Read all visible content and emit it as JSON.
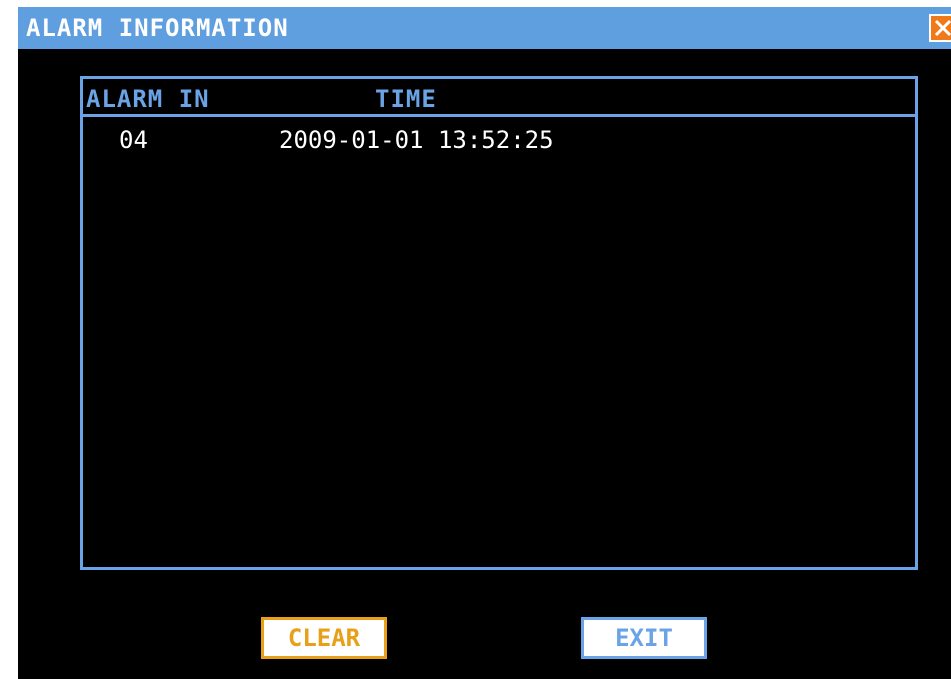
{
  "window": {
    "title": "ALARM INFORMATION"
  },
  "list": {
    "columns": {
      "alarm_in": "ALARM IN",
      "time": "TIME"
    },
    "rows": [
      {
        "alarm_in": "04",
        "time": "2009-01-01 13:52:25"
      }
    ]
  },
  "buttons": {
    "clear_label": "CLEAR",
    "exit_label": "EXIT"
  },
  "icons": {
    "close": "close-icon"
  },
  "colors": {
    "titlebar": "#5f9fe0",
    "accent_blue": "#6aa4e6",
    "clear_orange": "#e8a019",
    "close_orange": "#f07a1a",
    "background": "#000000"
  }
}
